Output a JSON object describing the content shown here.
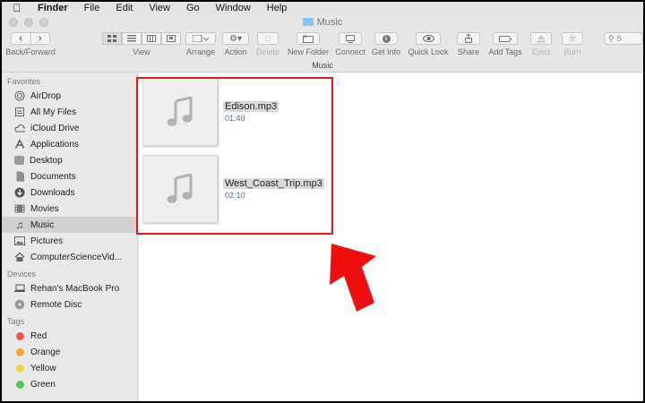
{
  "menubar": {
    "items": [
      "Finder",
      "File",
      "Edit",
      "View",
      "Go",
      "Window",
      "Help"
    ]
  },
  "window": {
    "title": "Music"
  },
  "toolbar": {
    "back_forward": "Back/Forward",
    "view": "View",
    "arrange": "Arrange",
    "action": "Action",
    "delete": "Delete",
    "new_folder": "New Folder",
    "connect": "Connect",
    "get_info": "Get Info",
    "quick_look": "Quick Look",
    "share": "Share",
    "add_tags": "Add Tags",
    "eject": "Eject",
    "burn": "Burn"
  },
  "pathbar": {
    "label": "Music"
  },
  "sidebar": {
    "favorites_header": "Favorites",
    "favorites": [
      {
        "label": "AirDrop",
        "icon": "airdrop-icon"
      },
      {
        "label": "All My Files",
        "icon": "all-files-icon"
      },
      {
        "label": "iCloud Drive",
        "icon": "cloud-icon"
      },
      {
        "label": "Applications",
        "icon": "applications-icon"
      },
      {
        "label": "Desktop",
        "icon": "desktop-icon"
      },
      {
        "label": "Documents",
        "icon": "documents-icon"
      },
      {
        "label": "Downloads",
        "icon": "downloads-icon"
      },
      {
        "label": "Movies",
        "icon": "movies-icon"
      },
      {
        "label": "Music",
        "icon": "music-note-icon",
        "selected": true
      },
      {
        "label": "Pictures",
        "icon": "pictures-icon"
      },
      {
        "label": "ComputerScienceVid...",
        "icon": "home-icon"
      }
    ],
    "devices_header": "Devices",
    "devices": [
      {
        "label": "Rehan's MacBook Pro",
        "icon": "laptop-icon"
      },
      {
        "label": "Remote Disc",
        "icon": "disc-icon"
      }
    ],
    "tags_header": "Tags",
    "tags": [
      {
        "label": "Red",
        "color": "#f1564a"
      },
      {
        "label": "Orange",
        "color": "#f3a33c"
      },
      {
        "label": "Yellow",
        "color": "#f3d23e"
      },
      {
        "label": "Green",
        "color": "#5cc25a"
      }
    ]
  },
  "files": [
    {
      "name": "Edison.mp3",
      "duration": "01:40",
      "icon": "music-note-icon"
    },
    {
      "name": "West_Coast_Trip.mp3",
      "duration": "02:10",
      "icon": "music-note-icon"
    }
  ],
  "annotation": {
    "highlight_color": "#e0191e",
    "arrow_color": "#f00d0d"
  }
}
